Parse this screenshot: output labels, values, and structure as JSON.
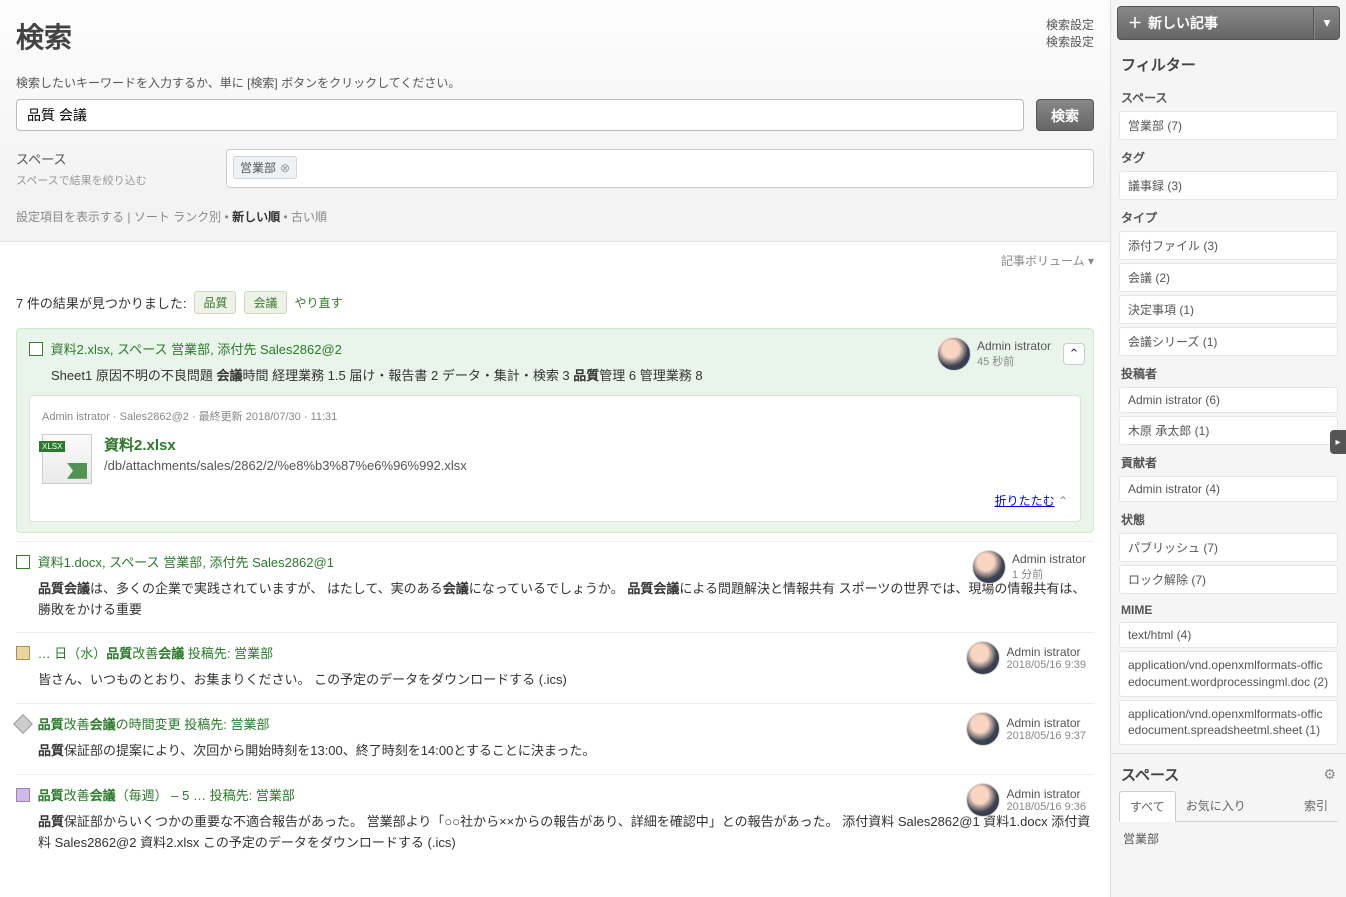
{
  "header": {
    "title": "検索",
    "link1": "検索設定",
    "link2": "検索設定",
    "instruction": "検索したいキーワードを入力するか、単に [検索] ボタンをクリックしてください。",
    "search_value": "品質 会議",
    "search_button": "検索",
    "space_label": "スペース",
    "space_sublabel": "スペースで結果を絞り込む",
    "space_tag": "営業部",
    "opts_show": "設定項目を表示する",
    "opts_sort": "ソート",
    "opts_rank": "ランク別",
    "opts_new": "新しい順",
    "opts_old": "古い順",
    "volume": "記事ボリューム"
  },
  "results": {
    "count_text": "7 件の結果が見つかりました:",
    "kw1": "品質",
    "kw2": "会議",
    "redo": "やり直す",
    "items": [
      {
        "icon": "doc",
        "title_html": "<a>資料2.xlsx</a>, スペース <a>営業部</a>, 添付先 <a>Sales2862@2</a>",
        "excerpt_html": "Sheet1 原因不明の不良問題 <b>会議</b>時間 経理業務 1.5 届け・報告書 2 データ・集計・検索 3 <b>品質</b>管理 6 管理業務 8",
        "author": "Admin istrator",
        "time": "45 秒前",
        "expanded": {
          "meta": "Admin istrator · Sales2862@2 · 最終更新 2018/07/30 · 11:31",
          "file_name": "資料2.xlsx",
          "file_path": "/db/attachments/sales/2862/2/%e8%b3%87%e6%96%992.xlsx",
          "collapse": "折りたたむ"
        }
      },
      {
        "icon": "doc",
        "title_html": "<a>資料1.docx</a>, スペース <a>営業部</a>, 添付先 <a>Sales2862@1</a>",
        "excerpt_html": "<b>品質会議</b>は、多くの企業で実践されていますが、 はたして、実のある<b>会議</b>になっているでしょうか。 <b>品質会議</b>による問題解決と情報共有 スポーツの世界では、現場の情報共有は、勝敗をかける重要",
        "author": "Admin istrator",
        "time": "1 分前"
      },
      {
        "icon": "cal",
        "title_html": "<a>… 日（水）<b>品質</b>改善<b>会議</b></a> 投稿先: <a>営業部</a>",
        "excerpt_html": "皆さん、いつものとおり、お集まりください。 この予定のデータをダウンロードする (.ics)",
        "author": "Admin istrator",
        "time": "2018/05/16 9:39"
      },
      {
        "icon": "pin",
        "title_html": "<a><b>品質</b>改善<b>会議</b>の時間変更</a> 投稿先: <a>営業部</a>",
        "excerpt_html": "<b>品質</b>保証部の提案により、次回から開始時刻を13:00、終了時刻を14:00とすることに決まった。",
        "author": "Admin istrator",
        "time": "2018/05/16 9:37"
      },
      {
        "icon": "list",
        "title_html": "<a><b>品質</b>改善<b>会議</b>（毎週） – 5 …</a> 投稿先: <a>営業部</a>",
        "excerpt_html": "<b>品質</b>保証部からいくつかの重要な不適合報告があった。 営業部より「○○社から××からの報告があり、詳細を確認中」との報告があった。 添付資料 Sales2862@1 資料1.docx 添付資料 Sales2862@2 資料2.xlsx この予定のデータをダウンロードする (.ics)",
        "author": "Admin istrator",
        "time": "2018/05/16 9:36"
      }
    ]
  },
  "sidebar": {
    "new_article": "新しい記事",
    "filter_title": "フィルター",
    "groups": [
      {
        "h": "スペース",
        "items": [
          "営業部 (7)"
        ]
      },
      {
        "h": "タグ",
        "items": [
          "議事録 (3)"
        ]
      },
      {
        "h": "タイプ",
        "items": [
          "添付ファイル (3)",
          "会議 (2)",
          "決定事項 (1)",
          "会議シリーズ (1)"
        ]
      },
      {
        "h": "投稿者",
        "items": [
          "Admin istrator (6)",
          "木原 承太郎 (1)"
        ]
      },
      {
        "h": "貢献者",
        "items": [
          "Admin istrator (4)"
        ]
      },
      {
        "h": "状態",
        "items": [
          "パブリッシュ (7)",
          "ロック解除 (7)"
        ]
      },
      {
        "h": "MIME",
        "items": [
          "text/html (4)",
          "application/vnd.openxmlformats-officedocument.wordprocessingml.doc (2)",
          "application/vnd.openxmlformats-officedocument.spreadsheetml.sheet (1)"
        ]
      }
    ],
    "spaces_title": "スペース",
    "tabs": {
      "all": "すべて",
      "fav": "お気に入り",
      "index": "索引"
    },
    "space_items": [
      "営業部"
    ]
  }
}
